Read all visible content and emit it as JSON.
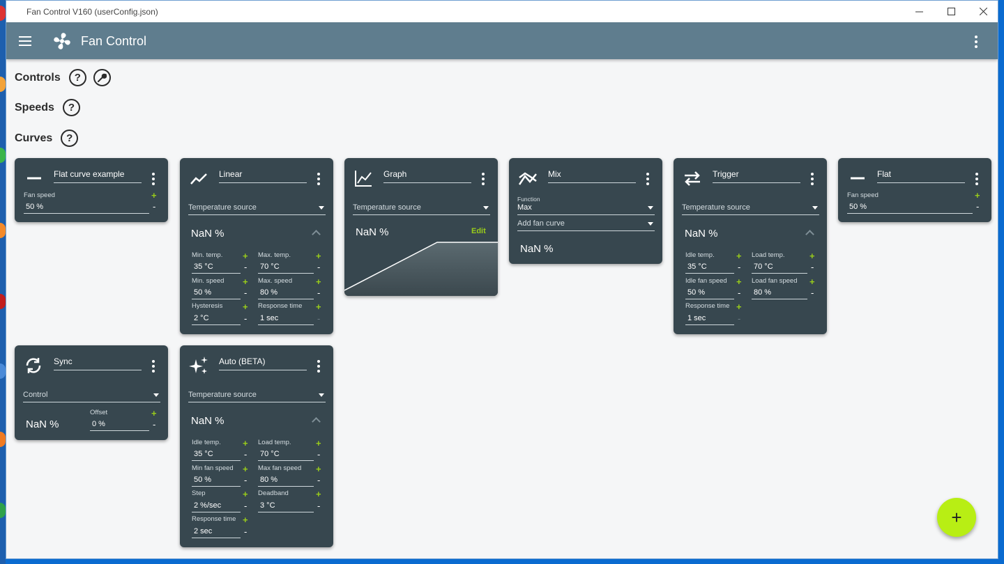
{
  "window": {
    "title": "Fan Control V160 (userConfig.json)"
  },
  "appbar": {
    "title": "Fan Control"
  },
  "sections": {
    "controls": "Controls",
    "speeds": "Speeds",
    "curves": "Curves",
    "help_glyph": "?"
  },
  "colors": {
    "accent": "#b8ee14",
    "card": "#37474f",
    "appbar": "#5f7d8e"
  },
  "cards": {
    "flat_example": {
      "name": "Flat curve example",
      "label": "Fan speed",
      "value": "50 %"
    },
    "linear": {
      "name": "Linear",
      "source": "Temperature source",
      "output": "NaN %",
      "min_temp_label": "Min. temp.",
      "min_temp": "35 °C",
      "max_temp_label": "Max. temp.",
      "max_temp": "70 °C",
      "min_speed_label": "Min. speed",
      "min_speed": "50 %",
      "max_speed_label": "Max. speed",
      "max_speed": "80 %",
      "hyst_label": "Hysteresis",
      "hyst": "2 °C",
      "resp_label": "Response time",
      "resp": "1 sec"
    },
    "graph": {
      "name": "Graph",
      "source": "Temperature source",
      "output": "NaN %",
      "edit": "Edit"
    },
    "mix": {
      "name": "Mix",
      "function_label": "Function",
      "function": "Max",
      "add": "Add fan curve",
      "output": "NaN %"
    },
    "trigger": {
      "name": "Trigger",
      "source": "Temperature source",
      "output": "NaN %",
      "idle_temp_label": "Idle temp.",
      "idle_temp": "35 °C",
      "load_temp_label": "Load temp.",
      "load_temp": "70 °C",
      "idle_speed_label": "Idle fan speed",
      "idle_speed": "50 %",
      "load_speed_label": "Load fan speed",
      "load_speed": "80 %",
      "resp_label": "Response time",
      "resp": "1 sec"
    },
    "flat": {
      "name": "Flat",
      "label": "Fan speed",
      "value": "50 %"
    },
    "sync": {
      "name": "Sync",
      "control": "Control",
      "output": "NaN %",
      "offset_label": "Offset",
      "offset": "0 %"
    },
    "auto": {
      "name": "Auto (BETA)",
      "source": "Temperature source",
      "output": "NaN %",
      "idle_temp_label": "Idle temp.",
      "idle_temp": "35 °C",
      "load_temp_label": "Load temp.",
      "load_temp": "70 °C",
      "min_speed_label": "Min fan speed",
      "min_speed": "50 %",
      "max_speed_label": "Max fan speed",
      "max_speed": "80 %",
      "step_label": "Step",
      "step": "2 %/sec",
      "deadband_label": "Deadband",
      "deadband": "3 °C",
      "resp_label": "Response time",
      "resp": "2 sec"
    }
  },
  "fab": {
    "glyph": "+"
  }
}
